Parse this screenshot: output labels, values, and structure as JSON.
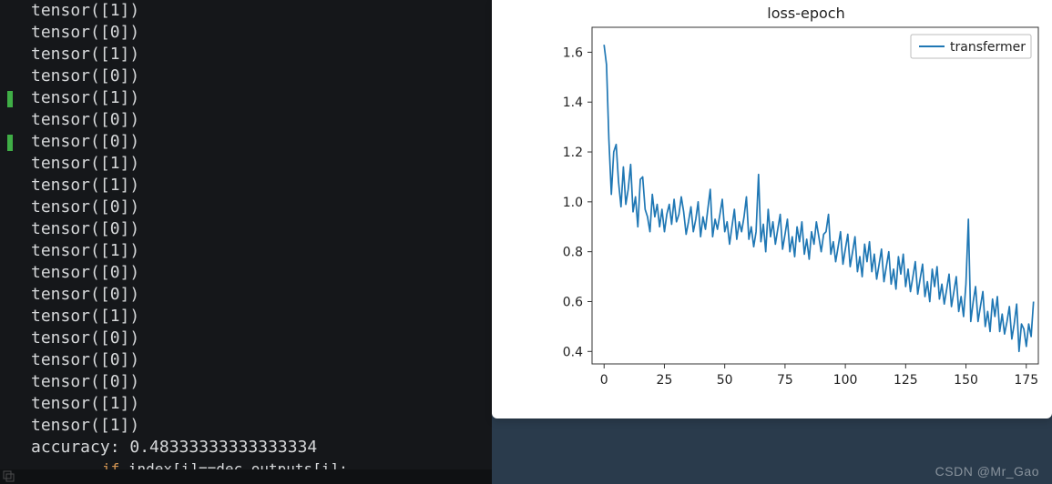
{
  "terminal": {
    "lines": [
      "tensor([1])",
      "tensor([0])",
      "tensor([1])",
      "tensor([0])",
      "tensor([1])",
      "tensor([0])",
      "tensor([0])",
      "tensor([1])",
      "tensor([1])",
      "tensor([0])",
      "tensor([0])",
      "tensor([1])",
      "tensor([0])",
      "tensor([0])",
      "tensor([1])",
      "tensor([0])",
      "tensor([0])",
      "tensor([0])",
      "tensor([1])",
      "tensor([1])",
      "accuracy: 0.48333333333333334"
    ],
    "gutter_marks_at_line_index": [
      5,
      7
    ],
    "code_tail": {
      "keyword": "if",
      "rest": " index[i]==dec_outputs[i]:"
    }
  },
  "chart_data": {
    "type": "line",
    "title": "loss-epoch",
    "xlabel": "",
    "ylabel": "",
    "xlim": [
      -5,
      180
    ],
    "ylim": [
      0.35,
      1.7
    ],
    "xticks": [
      0,
      25,
      50,
      75,
      100,
      125,
      150,
      175
    ],
    "yticks": [
      0.4,
      0.6,
      0.8,
      1.0,
      1.2,
      1.4,
      1.6
    ],
    "legend": {
      "position": "upper right",
      "entries": [
        "transfermer"
      ]
    },
    "series": [
      {
        "name": "transfermer",
        "color": "#1f77b4",
        "x_start": 0,
        "x_step": 1,
        "values": [
          1.63,
          1.55,
          1.25,
          1.03,
          1.2,
          1.23,
          1.08,
          0.98,
          1.14,
          0.99,
          1.05,
          1.15,
          0.96,
          1.02,
          0.9,
          1.09,
          1.1,
          0.97,
          0.94,
          0.88,
          1.03,
          0.94,
          0.99,
          0.9,
          0.97,
          0.88,
          0.95,
          0.99,
          0.91,
          1.01,
          0.92,
          0.95,
          1.02,
          0.96,
          0.87,
          0.92,
          0.98,
          0.88,
          0.93,
          1.0,
          0.86,
          0.94,
          0.89,
          0.97,
          1.05,
          0.86,
          0.93,
          0.89,
          0.95,
          1.01,
          0.88,
          0.92,
          0.83,
          0.9,
          0.97,
          0.85,
          0.92,
          0.88,
          0.94,
          1.02,
          0.85,
          0.9,
          0.82,
          0.88,
          1.11,
          0.84,
          0.91,
          0.8,
          0.97,
          0.86,
          0.92,
          0.83,
          0.89,
          0.95,
          0.81,
          0.87,
          0.93,
          0.8,
          0.86,
          0.78,
          0.9,
          0.84,
          0.92,
          0.79,
          0.85,
          0.77,
          0.88,
          0.83,
          0.92,
          0.86,
          0.8,
          0.87,
          0.88,
          0.95,
          0.79,
          0.84,
          0.76,
          0.82,
          0.88,
          0.75,
          0.81,
          0.87,
          0.74,
          0.8,
          0.86,
          0.72,
          0.78,
          0.7,
          0.83,
          0.76,
          0.84,
          0.72,
          0.79,
          0.69,
          0.75,
          0.81,
          0.68,
          0.74,
          0.8,
          0.67,
          0.73,
          0.65,
          0.78,
          0.71,
          0.79,
          0.66,
          0.73,
          0.64,
          0.7,
          0.76,
          0.63,
          0.69,
          0.75,
          0.62,
          0.68,
          0.6,
          0.73,
          0.66,
          0.74,
          0.61,
          0.67,
          0.59,
          0.65,
          0.71,
          0.58,
          0.64,
          0.7,
          0.56,
          0.62,
          0.54,
          0.67,
          0.93,
          0.52,
          0.6,
          0.66,
          0.52,
          0.58,
          0.64,
          0.5,
          0.56,
          0.48,
          0.61,
          0.54,
          0.62,
          0.48,
          0.55,
          0.47,
          0.52,
          0.58,
          0.45,
          0.51,
          0.59,
          0.4,
          0.51,
          0.49,
          0.42,
          0.51,
          0.46,
          0.6
        ]
      }
    ]
  },
  "watermark": "CSDN @Mr_Gao"
}
